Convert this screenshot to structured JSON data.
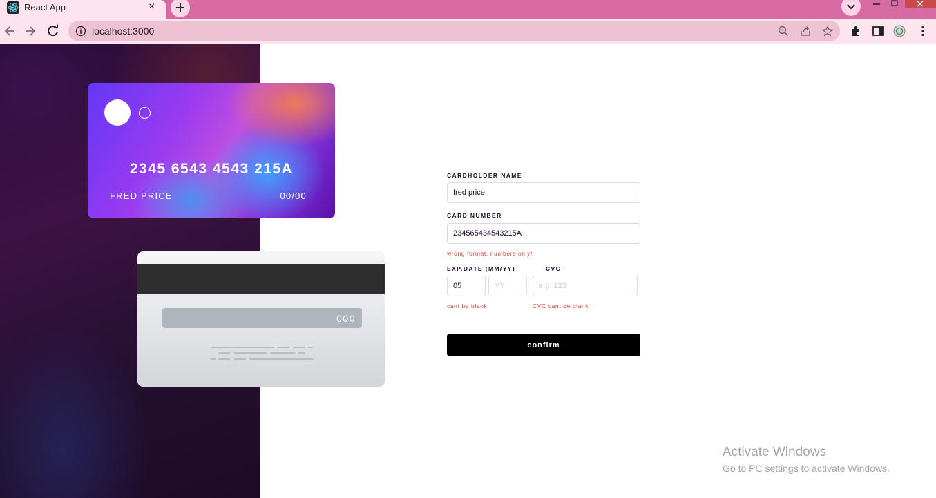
{
  "browser": {
    "tab_title": "React App",
    "tab_close": "×",
    "new_tab": "+",
    "url": "localhost:3000"
  },
  "card_front": {
    "number": "2345 6543 4543 215A",
    "name": "FRED PRICE",
    "expiry": "00/00"
  },
  "card_back": {
    "cvc": "000"
  },
  "form": {
    "cardholder_label": "CARDHOLDER NAME",
    "cardholder_value": "fred price",
    "card_number_label": "CARD NUMBER",
    "card_number_value": "234565434543215A",
    "card_number_error": "wrong format, numbers only!",
    "exp_label": "EXP.DATE (MM/YY)",
    "exp_month_value": "05",
    "exp_year_placeholder": "YY",
    "cvc_label": "CVC",
    "cvc_placeholder": "e.g. 123",
    "exp_error": "cant be blank",
    "cvc_error": "CVC cant be blank",
    "confirm_label": "confirm"
  },
  "watermark": {
    "title": "Activate Windows",
    "subtitle": "Go to PC settings to activate Windows."
  },
  "colors": {
    "tabstrip": "#d86aa3",
    "toolbar": "#fde4ef",
    "error": "#e0453c",
    "button": "#000000"
  }
}
